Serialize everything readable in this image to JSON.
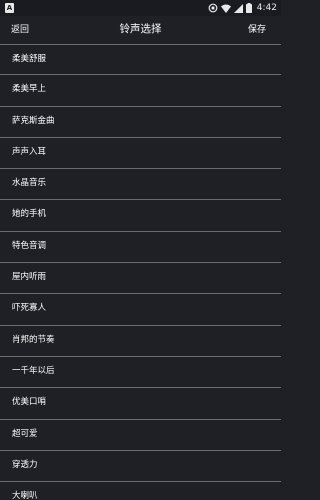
{
  "status_bar": {
    "app_icon_letter": "A",
    "time": "4:42"
  },
  "header": {
    "back_label": "返回",
    "title": "铃声选择",
    "save_label": "保存"
  },
  "ringtones": [
    {
      "label": "柔美舒服"
    },
    {
      "label": "柔美早上"
    },
    {
      "label": "萨克斯金曲"
    },
    {
      "label": "声声入耳"
    },
    {
      "label": "水晶音乐"
    },
    {
      "label": "她的手机"
    },
    {
      "label": "特色音调"
    },
    {
      "label": "屋内听雨"
    },
    {
      "label": "吓死寡人"
    },
    {
      "label": "肖邦的节奏"
    },
    {
      "label": "一千年以后"
    },
    {
      "label": "优美口哨"
    },
    {
      "label": "超可爱"
    },
    {
      "label": "穿透力"
    },
    {
      "label": "大喇叭"
    }
  ],
  "colors": {
    "background": "#1f2026",
    "divider": "#6b6c70",
    "text": "#ffffff"
  }
}
